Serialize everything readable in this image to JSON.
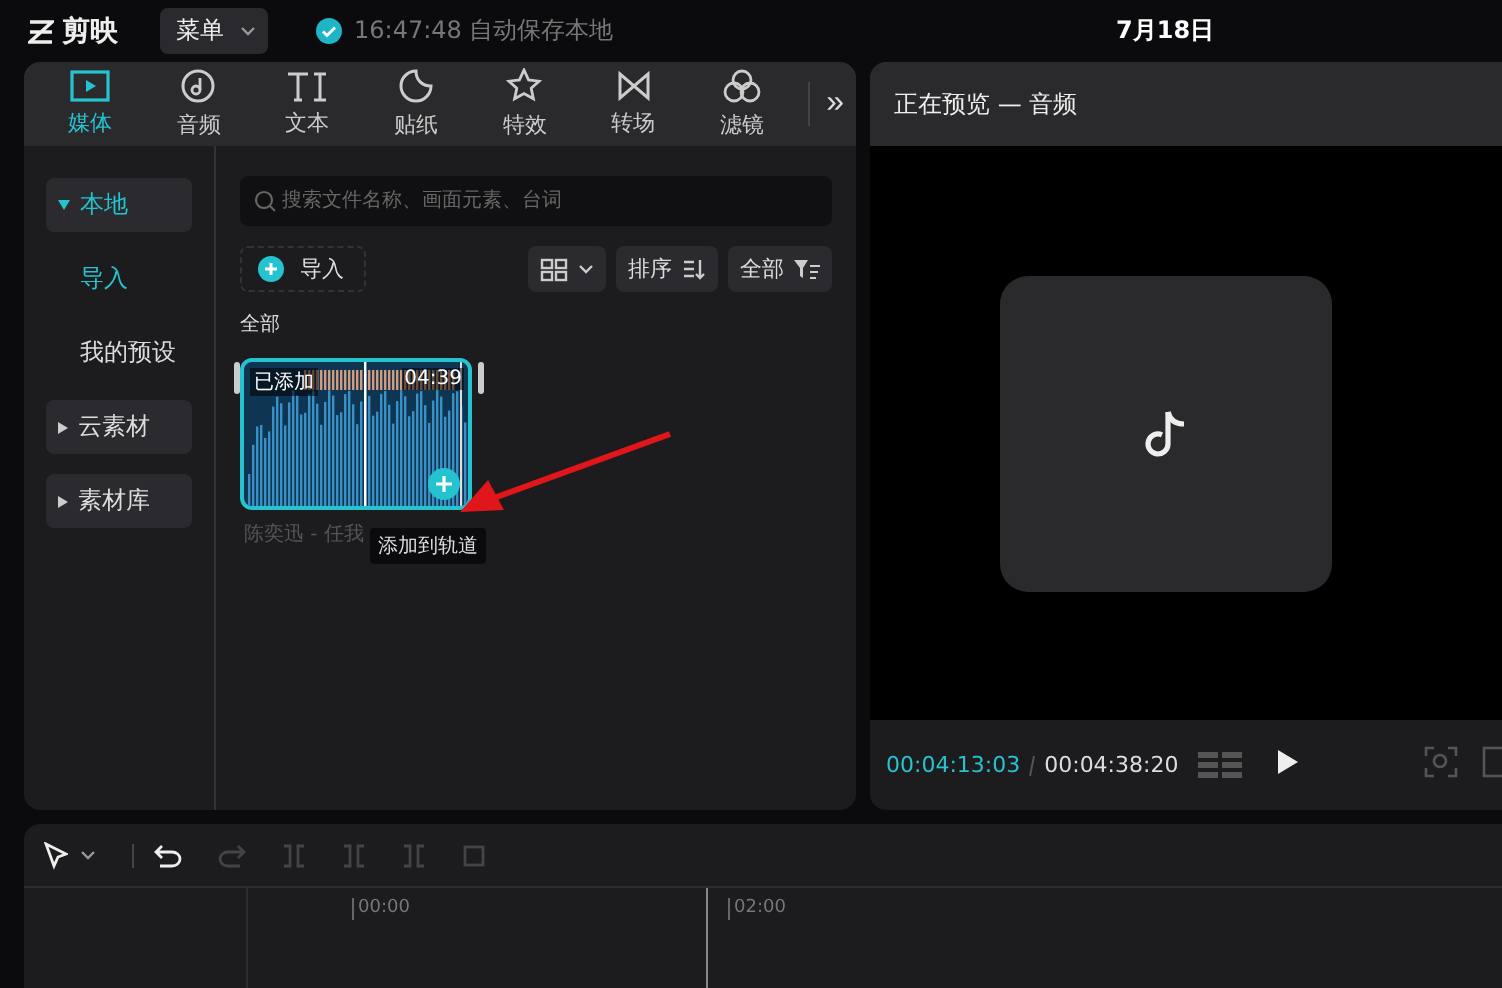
{
  "app": {
    "name": "剪映",
    "menu": "菜单",
    "autosave": "16:47:48 自动保存本地",
    "date": "7月18日"
  },
  "tabs": [
    {
      "label": "媒体",
      "selected": true
    },
    {
      "label": "音频",
      "selected": false
    },
    {
      "label": "文本",
      "selected": false
    },
    {
      "label": "贴纸",
      "selected": false
    },
    {
      "label": "特效",
      "selected": false
    },
    {
      "label": "转场",
      "selected": false
    },
    {
      "label": "滤镜",
      "selected": false
    }
  ],
  "more": "»",
  "sidebar": [
    {
      "label": "本地",
      "expanded": true,
      "children": [
        {
          "label": "导入",
          "selected": true
        },
        {
          "label": "我的预设",
          "selected": false
        }
      ]
    },
    {
      "label": "云素材",
      "expanded": false
    },
    {
      "label": "素材库",
      "expanded": false
    }
  ],
  "search": {
    "placeholder": "搜索文件名称、画面元素、台词"
  },
  "import_button": "导入",
  "sort_button": "排序",
  "filter_button": "全部",
  "section": "全部",
  "clip": {
    "badge": "已添加",
    "duration": "04:39",
    "caption": "陈奕迅 - 任我",
    "tooltip": "添加到轨道"
  },
  "preview": {
    "title": "正在预览 — 音频",
    "current": "00:04:13:03",
    "total": "00:04:38:20"
  },
  "timeline": {
    "ticks": [
      "00:00",
      "02:00"
    ]
  }
}
